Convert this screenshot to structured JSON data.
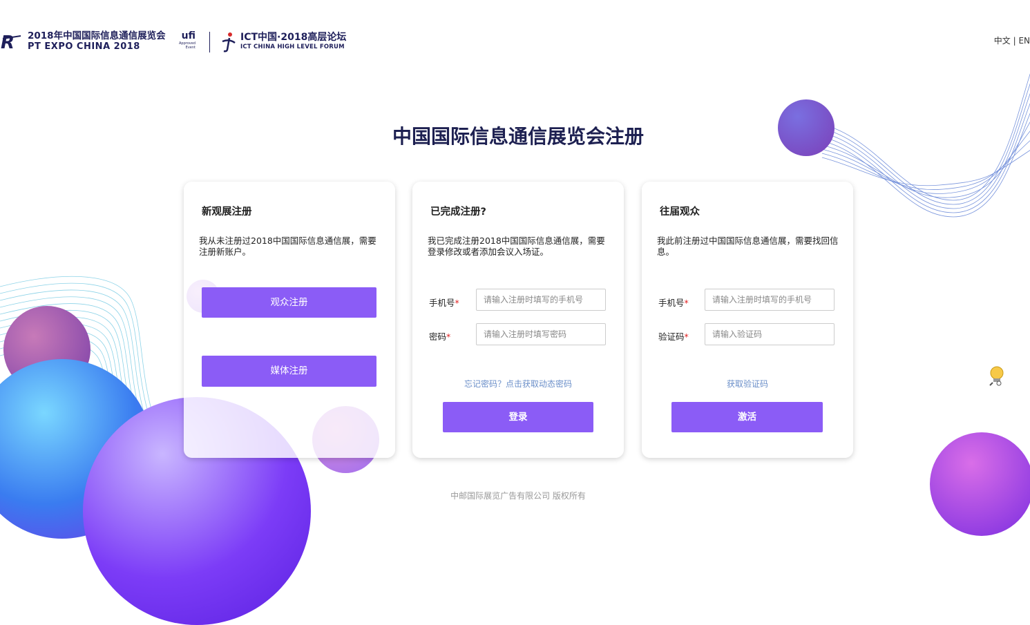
{
  "header": {
    "logo_line1": "2018年中国国际信息通信展览会",
    "logo_line2": "PT EXPO CHINA 2018",
    "ufi_main": "ufi",
    "ufi_sub1": "Approved",
    "ufi_sub2": "Event",
    "ict_line1": "ICT中国·2018高层论坛",
    "ict_line2": "ICT CHINA HIGH LEVEL FORUM",
    "lang_cn": "中文",
    "lang_sep": "|",
    "lang_en": "EN"
  },
  "page_title": "中国国际信息通信展览会注册",
  "card_new": {
    "title": "新观展注册",
    "desc": "我从未注册过2018中国国际信息通信展，需要注册新账户。",
    "audience_button": "观众注册",
    "media_button": "媒体注册"
  },
  "card_login": {
    "title": "已完成注册?",
    "desc": "我已完成注册2018中国国际信息通信展，需要登录修改或者添加会议入场证。",
    "phone_label": "手机号",
    "phone_placeholder": "请输入注册时填写的手机号",
    "password_label": "密码",
    "password_placeholder": "请输入注册时填写密码",
    "required_mark": "*",
    "forgot_link": "忘记密码？点击获取动态密码",
    "login_button": "登录"
  },
  "card_past": {
    "title": "往届观众",
    "desc": "我此前注册过中国国际信息通信展，需要找回信息。",
    "phone_label": "手机号",
    "phone_placeholder": "请输入注册时填写的手机号",
    "code_label": "验证码",
    "code_placeholder": "请输入验证码",
    "required_mark": "*",
    "get_code_link": "获取验证码",
    "activate_button": "激活"
  },
  "footer": "中邮国际展览广告有限公司 版权所有",
  "colors": {
    "accent": "#8b5cf6",
    "title": "#1d2051",
    "link": "#6b8fc9",
    "required": "#e02020"
  },
  "icons": [
    "pt-expo-logo-icon",
    "ufi-logo-icon",
    "ict-logo-icon",
    "lightbulb-icon"
  ]
}
